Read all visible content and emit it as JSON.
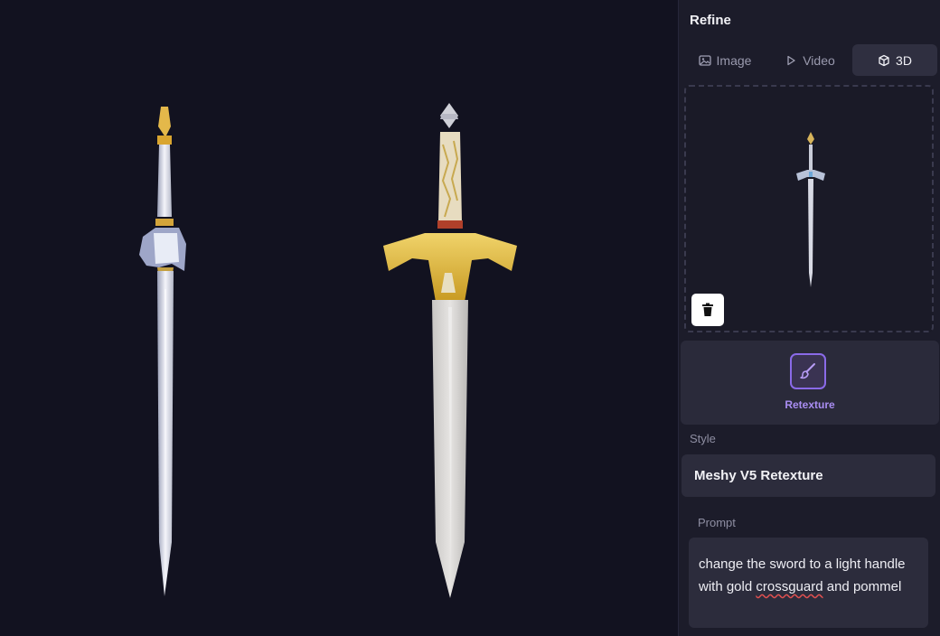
{
  "panel": {
    "title": "Refine",
    "tabs": [
      {
        "label": "Image",
        "icon": "image-icon"
      },
      {
        "label": "Video",
        "icon": "play-icon"
      },
      {
        "label": "3D",
        "icon": "cube-icon"
      }
    ],
    "active_tab": "3D",
    "tool": {
      "label": "Retexture",
      "icon": "brush-icon"
    },
    "style": {
      "label": "Style",
      "value": "Meshy V5 Retexture"
    },
    "prompt": {
      "label": "Prompt",
      "text_before": "change the sword to a light handle with gold ",
      "misspelled_word": "crossguard",
      "text_after": " and pommel"
    }
  },
  "colors": {
    "background": "#121220",
    "panel": "#1c1c2a",
    "accent": "#8a6ae8",
    "gold": "#d9b53a",
    "blade": "#d8d8dc"
  }
}
